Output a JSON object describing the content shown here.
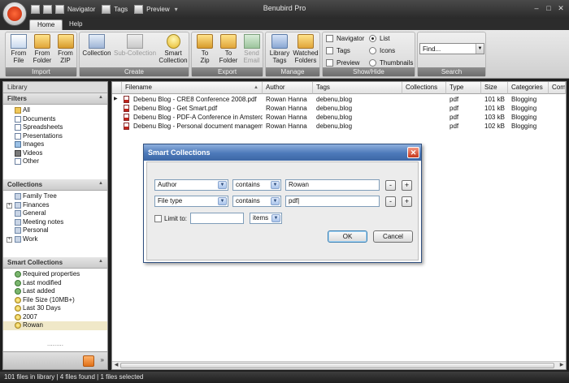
{
  "app": {
    "title": "Benubird Pro",
    "quick_access": {
      "navigator": "Navigator",
      "tags": "Tags",
      "preview": "Preview"
    }
  },
  "ribbon": {
    "tabs": [
      {
        "label": "Home"
      },
      {
        "label": "Help"
      }
    ],
    "groups": {
      "import": {
        "label": "Import",
        "buttons": [
          {
            "label": "From\nFile"
          },
          {
            "label": "From\nFolder"
          },
          {
            "label": "From\nZIP"
          }
        ]
      },
      "create": {
        "label": "Create",
        "buttons": [
          {
            "label": "Collection"
          },
          {
            "label": "Sub-Collection"
          },
          {
            "label": "Smart\nCollection"
          }
        ]
      },
      "export": {
        "label": "Export",
        "buttons": [
          {
            "label": "To\nZip"
          },
          {
            "label": "To\nFolder"
          },
          {
            "label": "Send\nEmail"
          }
        ]
      },
      "manage": {
        "label": "Manage",
        "buttons": [
          {
            "label": "Library\nTags"
          },
          {
            "label": "Watched\nFolders"
          }
        ]
      },
      "showhide": {
        "label": "Show/Hide",
        "checks": [
          {
            "label": "Navigator"
          },
          {
            "label": "Tags"
          },
          {
            "label": "Preview"
          }
        ],
        "radios": [
          {
            "label": "List",
            "selected": true
          },
          {
            "label": "Icons",
            "selected": false
          },
          {
            "label": "Thumbnails",
            "selected": false
          }
        ]
      },
      "search": {
        "label": "Search",
        "placeholder": "Find..."
      }
    }
  },
  "left": {
    "library_title": "Library",
    "filters": {
      "title": "Filters",
      "items": [
        {
          "label": "All",
          "icon": "folder-icon"
        },
        {
          "label": "Documents",
          "icon": "document-icon"
        },
        {
          "label": "Spreadsheets",
          "icon": "document-icon"
        },
        {
          "label": "Presentations",
          "icon": "document-icon"
        },
        {
          "label": "Images",
          "icon": "image-icon"
        },
        {
          "label": "Videos",
          "icon": "video-icon"
        },
        {
          "label": "Other",
          "icon": "document-icon"
        }
      ]
    },
    "collections": {
      "title": "Collections",
      "items": [
        {
          "label": "Family Tree",
          "expandable": false
        },
        {
          "label": "Finances",
          "expandable": true
        },
        {
          "label": "General",
          "expandable": false
        },
        {
          "label": "Meeting notes",
          "expandable": false
        },
        {
          "label": "Personal",
          "expandable": false
        },
        {
          "label": "Work",
          "expandable": true
        }
      ]
    },
    "smart_collections": {
      "title": "Smart Collections",
      "items": [
        {
          "label": "Required properties",
          "icon": "gear-icon"
        },
        {
          "label": "Last modified",
          "icon": "clock-icon"
        },
        {
          "label": "Last added",
          "icon": "clock-icon"
        },
        {
          "label": "File Size (10MB+)",
          "icon": "bulb-icon"
        },
        {
          "label": "Last 30 Days",
          "icon": "bulb-icon"
        },
        {
          "label": "2007",
          "icon": "bulb-icon"
        },
        {
          "label": "Rowan",
          "icon": "bulb-icon",
          "selected": true
        }
      ]
    }
  },
  "grid": {
    "columns": [
      {
        "label": "Filename"
      },
      {
        "label": "Author"
      },
      {
        "label": "Tags"
      },
      {
        "label": "Collections"
      },
      {
        "label": "Type"
      },
      {
        "label": "Size"
      },
      {
        "label": "Categories"
      },
      {
        "label": "Comm"
      }
    ],
    "rows": [
      {
        "filename": "Debenu Blog - CRE8 Conference 2008.pdf",
        "author": "Rowan Hanna",
        "tags": "debenu,blog",
        "collections": "",
        "type": "pdf",
        "size": "101 kB",
        "categories": "Blogging",
        "current": true
      },
      {
        "filename": "Debenu Blog - Get Smart.pdf",
        "author": "Rowan Hanna",
        "tags": "debenu,blog",
        "collections": "",
        "type": "pdf",
        "size": "101 kB",
        "categories": "Blogging",
        "current": false
      },
      {
        "filename": "Debenu Blog - PDF-A Conference in Amsterdam...",
        "author": "Rowan Hanna",
        "tags": "debenu,blog",
        "collections": "",
        "type": "pdf",
        "size": "103 kB",
        "categories": "Blogging",
        "current": false
      },
      {
        "filename": "Debenu Blog - Personal document management...",
        "author": "Rowan Hanna",
        "tags": "debenu,blog",
        "collections": "",
        "type": "pdf",
        "size": "102 kB",
        "categories": "Blogging",
        "current": false
      }
    ]
  },
  "status": {
    "text": "101 files in library | 4 files found | 1 files selected"
  },
  "dialog": {
    "title": "Smart Collections",
    "rules": [
      {
        "field": "Author",
        "operator": "contains",
        "value": "Rowan"
      },
      {
        "field": "File type",
        "operator": "contains",
        "value": "pdf"
      }
    ],
    "limit": {
      "label": "Limit to:",
      "value": "",
      "unit": "items",
      "checked": false
    },
    "ok_label": "OK",
    "cancel_label": "Cancel",
    "minus": "-",
    "plus": "+"
  },
  "colors": {
    "title_bar": "#2a2a2a",
    "dialog_title": "#4c79b9",
    "selection": "#f0e8c8",
    "pdf_red": "#c0241c"
  }
}
